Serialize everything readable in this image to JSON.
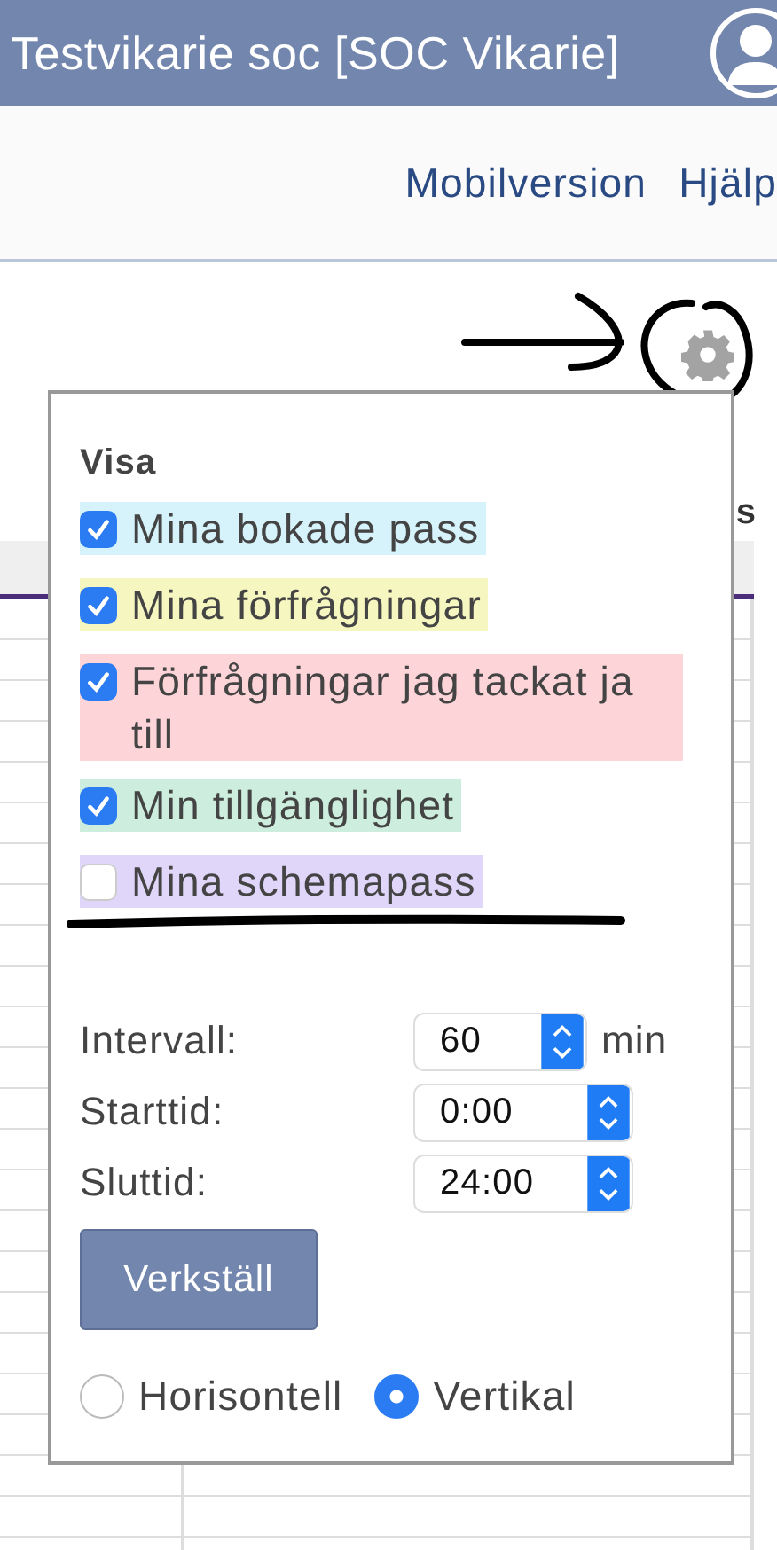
{
  "header": {
    "title": "Testvikarie soc [SOC Vikarie]"
  },
  "nav": {
    "links": [
      "Mobilversion",
      "Hjälp"
    ]
  },
  "table": {
    "column_heading": "s"
  },
  "popup": {
    "heading": "Visa",
    "options": [
      {
        "label": "Mina bokade pass",
        "checked": true,
        "color": "#d6f3fc"
      },
      {
        "label": "Mina förfrågningar",
        "checked": true,
        "color": "#f6f6c0"
      },
      {
        "label": "Förfrågningar jag tackat ja till",
        "checked": true,
        "color": "#fdd5d9"
      },
      {
        "label": "Min tillgänglighet",
        "checked": true,
        "color": "#cdeedf"
      },
      {
        "label": "Mina schemapass",
        "checked": false,
        "color": "#e0d6fa"
      }
    ],
    "settings": [
      {
        "label": "Intervall:",
        "value": "60",
        "unit": "min",
        "kind": "short"
      },
      {
        "label": "Starttid:",
        "value": "0:00",
        "kind": "wide"
      },
      {
        "label": "Sluttid:",
        "value": "24:00",
        "kind": "wide"
      }
    ],
    "apply_button": "Verkställ",
    "orientation": [
      {
        "label": "Horisontell",
        "selected": false
      },
      {
        "label": "Vertikal",
        "selected": true
      }
    ]
  }
}
